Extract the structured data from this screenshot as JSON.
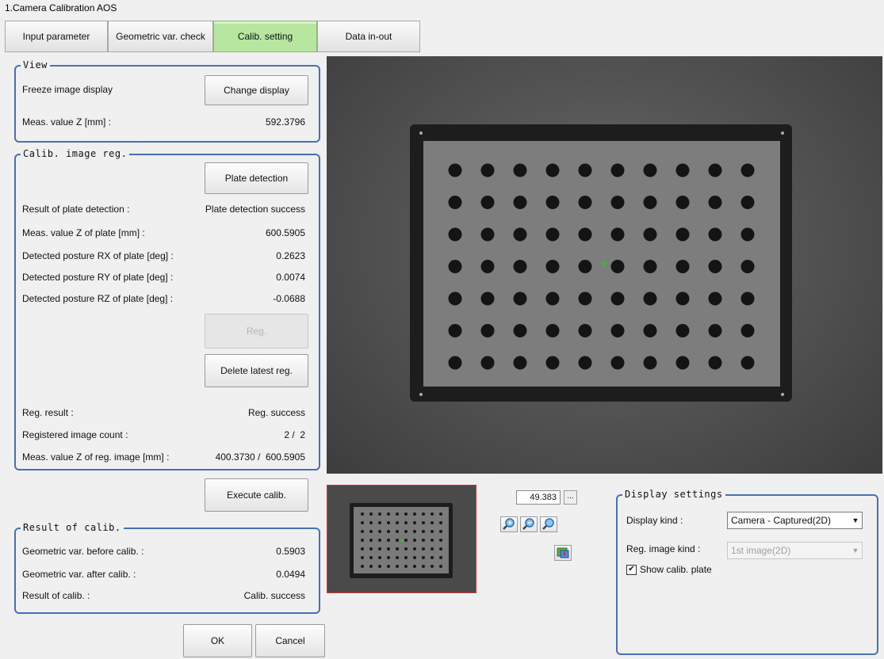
{
  "window": {
    "title": "1.Camera Calibration AOS"
  },
  "tabs": [
    {
      "label": "Input parameter"
    },
    {
      "label": "Geometric var. check"
    },
    {
      "label": "Calib. setting"
    },
    {
      "label": "Data in-out"
    }
  ],
  "view": {
    "title": "View",
    "freeze_label": "Freeze image display",
    "change_display_button": "Change display",
    "meas_z_label": "Meas. value Z [mm] :",
    "meas_z_value": "592.3796"
  },
  "calib_image_reg": {
    "title": "Calib. image reg.",
    "plate_detection_button": "Plate detection",
    "rows": [
      {
        "label": "Result of plate detection :",
        "value": "Plate detection success"
      },
      {
        "label": "Meas. value Z of plate [mm] :",
        "value": "600.5905"
      },
      {
        "label": "Detected posture RX of plate [deg] :",
        "value": "0.2623"
      },
      {
        "label": "Detected posture RY of plate [deg] :",
        "value": "0.0074"
      },
      {
        "label": "Detected posture RZ of plate [deg] :",
        "value": "-0.0688"
      }
    ],
    "reg_button": "Reg.",
    "delete_button": "Delete latest reg.",
    "rows2": [
      {
        "label": "Reg. result :",
        "value": "Reg. success"
      },
      {
        "label": "Registered image count :",
        "value": "2 /  2"
      },
      {
        "label": "Meas. value Z of reg. image [mm] :",
        "value": "400.3730 /  600.5905"
      }
    ]
  },
  "execute_calib_button": "Execute calib.",
  "result": {
    "title": "Result of calib.",
    "rows": [
      {
        "label": "Geometric var. before calib. :",
        "value": "0.5903"
      },
      {
        "label": "Geometric var. after calib. :",
        "value": "0.0494"
      },
      {
        "label": "Result of calib. :",
        "value": "Calib. success"
      }
    ]
  },
  "footer": {
    "ok": "OK",
    "cancel": "Cancel"
  },
  "zoom": {
    "value": "49.383",
    "more": "..."
  },
  "display_settings": {
    "title": "Display settings",
    "display_kind_label": "Display kind :",
    "display_kind_value": "Camera - Captured(2D)",
    "reg_image_kind_label": "Reg. image kind :",
    "reg_image_kind_value": "1st image(2D)",
    "show_plate_label": "Show calib. plate",
    "show_plate_checked": true
  },
  "icons": [
    "zoom-in-icon",
    "zoom-out-icon",
    "zoom-fit-icon",
    "image-switch-icon"
  ],
  "colors": {
    "group_border": "#4a6fb4",
    "active_tab": "#b7e6a0",
    "thumb_border": "#dd3333",
    "crosshair": "#22cc22"
  }
}
